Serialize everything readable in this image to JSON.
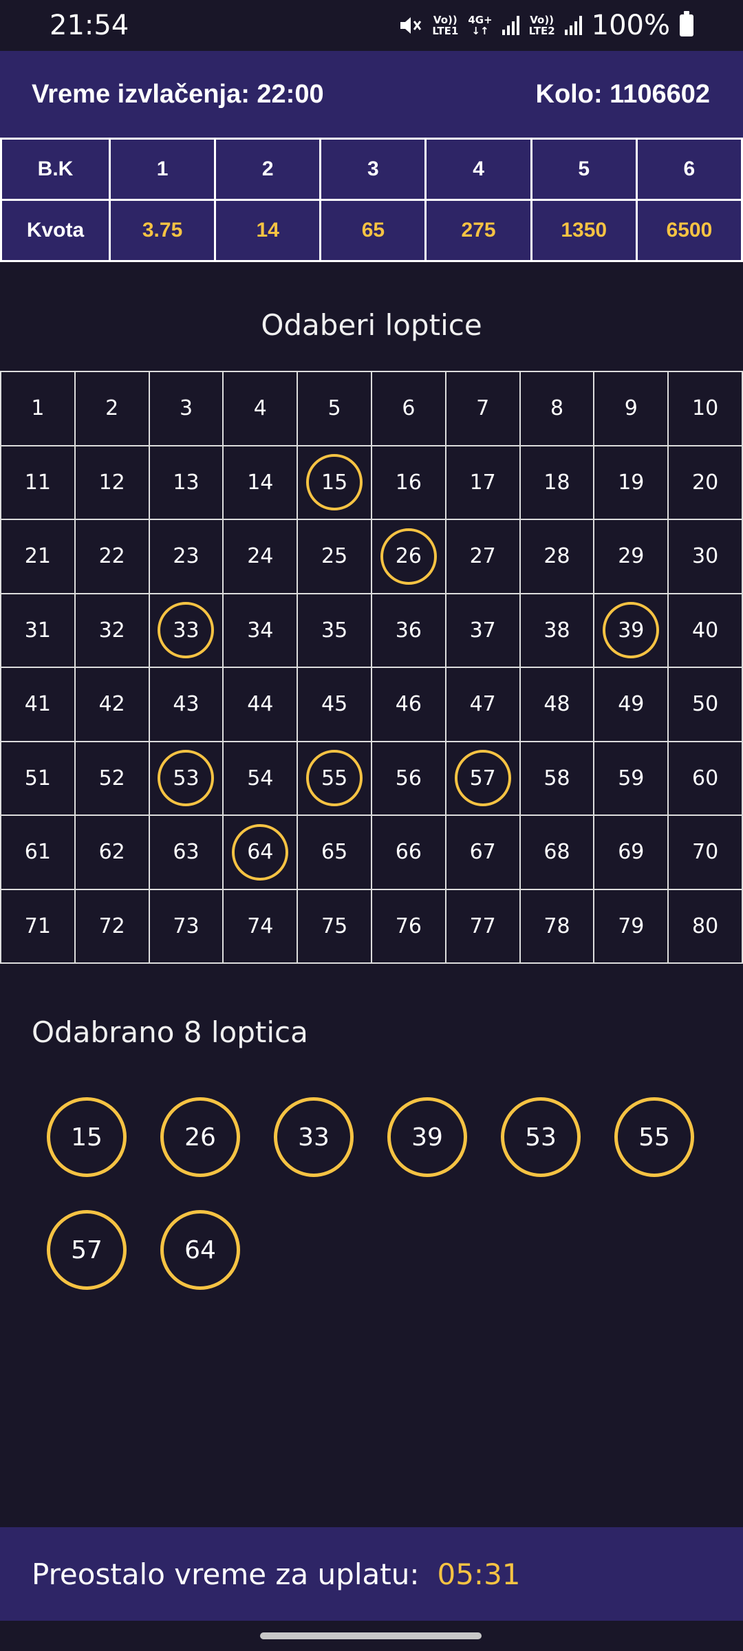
{
  "status_bar": {
    "time": "21:54",
    "sim1_top": "Vo))",
    "sim1_bottom": "LTE1",
    "net_top": "4G+",
    "net_bottom": "↓↑",
    "sim2_top": "Vo))",
    "sim2_bottom": "LTE2",
    "battery": "100%",
    "icons": [
      "mute-icon",
      "signal-icon",
      "battery-icon"
    ]
  },
  "header": {
    "draw_time": "Vreme izvlačenja: 22:00",
    "round": "Kolo: 1106602"
  },
  "odds": {
    "row1_label": "B.K",
    "row2_label": "Kvota",
    "columns": [
      {
        "count": "1",
        "odd": "3.75"
      },
      {
        "count": "2",
        "odd": "14"
      },
      {
        "count": "3",
        "odd": "65"
      },
      {
        "count": "4",
        "odd": "275"
      },
      {
        "count": "5",
        "odd": "1350"
      },
      {
        "count": "6",
        "odd": "6500"
      }
    ]
  },
  "pick_title": "Odaberi loptice",
  "grid": {
    "numbers": [
      "1",
      "2",
      "3",
      "4",
      "5",
      "6",
      "7",
      "8",
      "9",
      "10",
      "11",
      "12",
      "13",
      "14",
      "15",
      "16",
      "17",
      "18",
      "19",
      "20",
      "21",
      "22",
      "23",
      "24",
      "25",
      "26",
      "27",
      "28",
      "29",
      "30",
      "31",
      "32",
      "33",
      "34",
      "35",
      "36",
      "37",
      "38",
      "39",
      "40",
      "41",
      "42",
      "43",
      "44",
      "45",
      "46",
      "47",
      "48",
      "49",
      "50",
      "51",
      "52",
      "53",
      "54",
      "55",
      "56",
      "57",
      "58",
      "59",
      "60",
      "61",
      "62",
      "63",
      "64",
      "65",
      "66",
      "67",
      "68",
      "69",
      "70",
      "71",
      "72",
      "73",
      "74",
      "75",
      "76",
      "77",
      "78",
      "79",
      "80"
    ],
    "selected": [
      "15",
      "26",
      "33",
      "39",
      "53",
      "55",
      "57",
      "64"
    ]
  },
  "chosen": {
    "title": "Odabrano 8 loptica",
    "balls": [
      "15",
      "26",
      "33",
      "39",
      "53",
      "55",
      "57",
      "64"
    ]
  },
  "footer": {
    "label": "Preostalo vreme za uplatu:",
    "timer": "05:31"
  },
  "colors": {
    "background": "#191628",
    "panel": "#2e2566",
    "accent": "#f6c343"
  }
}
